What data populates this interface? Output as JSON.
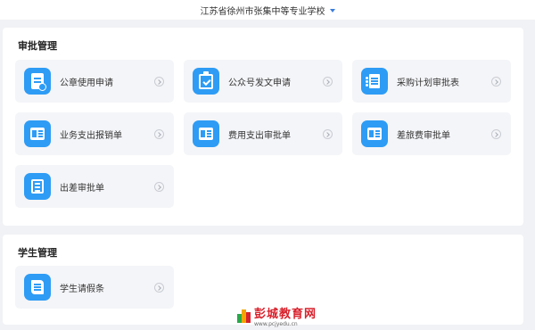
{
  "header": {
    "school_name": "江苏省徐州市张集中等专业学校"
  },
  "sections": [
    {
      "title": "审批管理",
      "items": [
        {
          "label": "公章使用申请",
          "icon": "seal-document-icon"
        },
        {
          "label": "公众号发文申请",
          "icon": "clipboard-check-icon"
        },
        {
          "label": "采购计划审批表",
          "icon": "form-list-icon"
        },
        {
          "label": "业务支出报销单",
          "icon": "newspaper-icon"
        },
        {
          "label": "费用支出审批单",
          "icon": "newspaper-icon"
        },
        {
          "label": "差旅费审批单",
          "icon": "newspaper-icon"
        },
        {
          "label": "出差审批单",
          "icon": "list-document-icon"
        }
      ]
    },
    {
      "title": "学生管理",
      "items": [
        {
          "label": "学生请假条",
          "icon": "scroll-icon"
        }
      ]
    }
  ],
  "watermark": {
    "name": "彭城教育网",
    "url": "www.pcjyedu.cn"
  },
  "colors": {
    "accent": "#2e9cf5",
    "background": "#f1f2f5",
    "tile": "#f4f5f8"
  }
}
